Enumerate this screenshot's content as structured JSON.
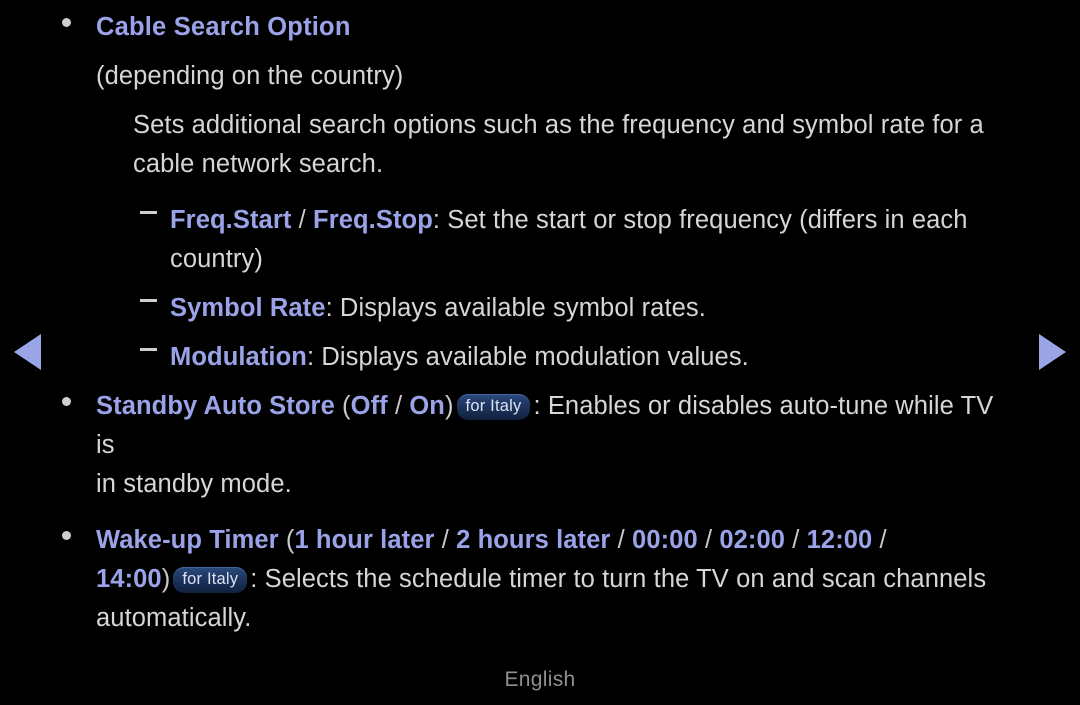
{
  "page": {
    "background_color": "#000000",
    "body_text_color": "#d6d6d6",
    "accent_color": "#9aa3e8",
    "badge_color": "#1d3560",
    "footer_language": "English"
  },
  "nav": {
    "prev_label": "◀",
    "next_label": "▶"
  },
  "sections": [
    {
      "id": "cable-search-option",
      "heading": "Cable Search Option",
      "subtitle": "(depending on the country)",
      "description_line_1": "Sets additional search options such as the frequency and symbol rate for a",
      "description_line_2": "cable network search.",
      "items": [
        {
          "id": "freq-start-stop",
          "keyword_1": "Freq.Start",
          "separator": " / ",
          "keyword_2": "Freq.Stop",
          "description_line_1": ": Set the start or stop frequency (differs in each",
          "description_line_2": "country)"
        },
        {
          "id": "symbol-rate",
          "keyword_1": "Symbol Rate",
          "description_line_1": ": Displays available symbol rates."
        },
        {
          "id": "modulation",
          "keyword_1": "Modulation",
          "description_line_1": ": Displays available modulation values."
        }
      ]
    },
    {
      "id": "standby-auto-store",
      "heading": "Standby Auto Store",
      "open_paren": " (",
      "option_1": "Off",
      "option_sep_1": " / ",
      "option_2": "On",
      "close_paren": ")",
      "badge": "for Italy",
      "description_line_1": ": Enables or disables auto-tune while TV is",
      "description_line_2": "in standby mode."
    },
    {
      "id": "wake-up-timer",
      "heading": "Wake-up Timer",
      "open_paren": " (",
      "option_1": "1 hour later",
      "option_sep_1": " / ",
      "option_2": "2 hours later",
      "option_sep_2": " / ",
      "option_3": "00:00",
      "option_sep_3": " / ",
      "option_4": "02:00",
      "option_sep_4": " / ",
      "option_5": "12:00",
      "option_sep_5": " / ",
      "option_6": "14:00",
      "close_paren": ")",
      "badge": "for Italy",
      "description_line_1": ": Selects the schedule timer to turn the TV on and scan channels",
      "description_line_2": "automatically."
    }
  ]
}
